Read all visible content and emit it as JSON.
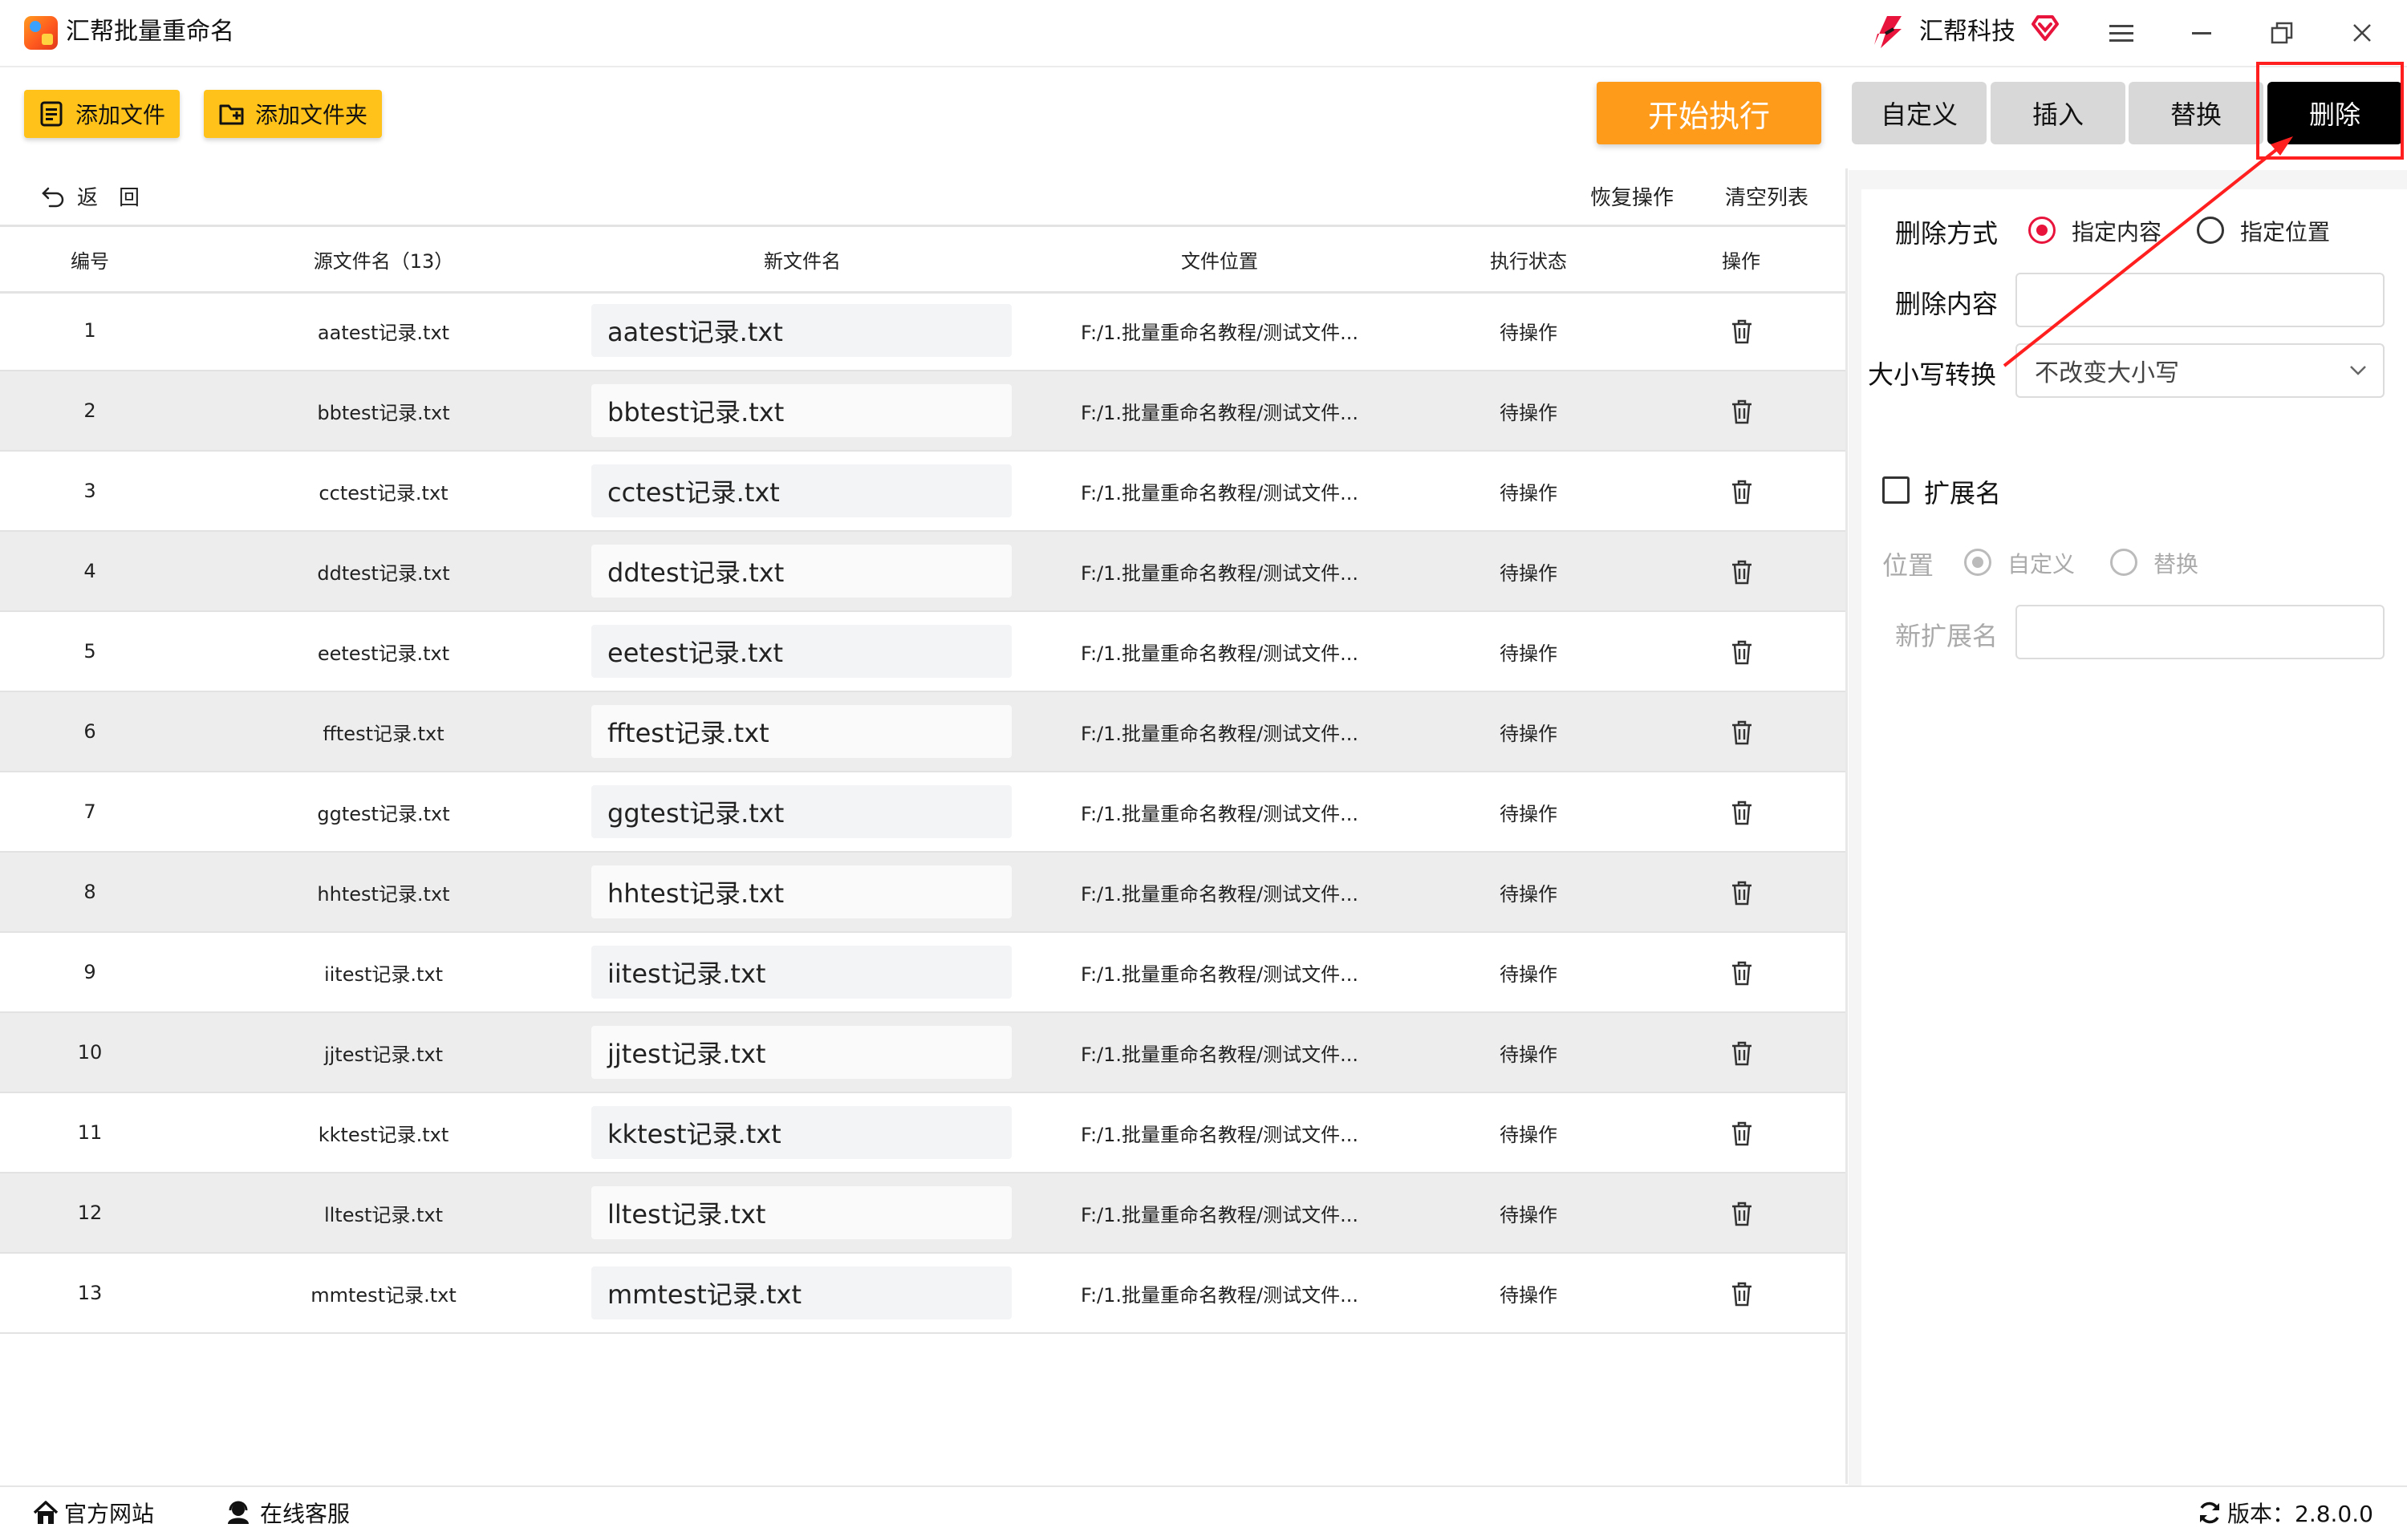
{
  "app": {
    "title": "汇帮批量重命名",
    "brand": "汇帮科技"
  },
  "toolbar": {
    "add_file": "添加文件",
    "add_folder": "添加文件夹",
    "start": "开始执行",
    "tabs": [
      "自定义",
      "插入",
      "替换",
      "删除"
    ],
    "active_tab": "删除"
  },
  "list_toolbar": {
    "back": "返　回",
    "restore": "恢复操作",
    "clear": "清空列表"
  },
  "table": {
    "headers": [
      "编号",
      "源文件名（13）",
      "新文件名",
      "文件位置",
      "执行状态",
      "操作"
    ],
    "rows": [
      {
        "no": "1",
        "src": "aatest记录.txt",
        "new": "aatest记录.txt",
        "path": "F:/1.批量重命名教程/测试文件...",
        "status": "待操作"
      },
      {
        "no": "2",
        "src": "bbtest记录.txt",
        "new": "bbtest记录.txt",
        "path": "F:/1.批量重命名教程/测试文件...",
        "status": "待操作"
      },
      {
        "no": "3",
        "src": "cctest记录.txt",
        "new": "cctest记录.txt",
        "path": "F:/1.批量重命名教程/测试文件...",
        "status": "待操作"
      },
      {
        "no": "4",
        "src": "ddtest记录.txt",
        "new": "ddtest记录.txt",
        "path": "F:/1.批量重命名教程/测试文件...",
        "status": "待操作"
      },
      {
        "no": "5",
        "src": "eetest记录.txt",
        "new": "eetest记录.txt",
        "path": "F:/1.批量重命名教程/测试文件...",
        "status": "待操作"
      },
      {
        "no": "6",
        "src": "fftest记录.txt",
        "new": "fftest记录.txt",
        "path": "F:/1.批量重命名教程/测试文件...",
        "status": "待操作"
      },
      {
        "no": "7",
        "src": "ggtest记录.txt",
        "new": "ggtest记录.txt",
        "path": "F:/1.批量重命名教程/测试文件...",
        "status": "待操作"
      },
      {
        "no": "8",
        "src": "hhtest记录.txt",
        "new": "hhtest记录.txt",
        "path": "F:/1.批量重命名教程/测试文件...",
        "status": "待操作"
      },
      {
        "no": "9",
        "src": "iitest记录.txt",
        "new": "iitest记录.txt",
        "path": "F:/1.批量重命名教程/测试文件...",
        "status": "待操作"
      },
      {
        "no": "10",
        "src": "jjtest记录.txt",
        "new": "jjtest记录.txt",
        "path": "F:/1.批量重命名教程/测试文件...",
        "status": "待操作"
      },
      {
        "no": "11",
        "src": "kktest记录.txt",
        "new": "kktest记录.txt",
        "path": "F:/1.批量重命名教程/测试文件...",
        "status": "待操作"
      },
      {
        "no": "12",
        "src": "lltest记录.txt",
        "new": "lltest记录.txt",
        "path": "F:/1.批量重命名教程/测试文件...",
        "status": "待操作"
      },
      {
        "no": "13",
        "src": "mmtest记录.txt",
        "new": "mmtest记录.txt",
        "path": "F:/1.批量重命名教程/测试文件...",
        "status": "待操作"
      }
    ]
  },
  "panel": {
    "delete_mode_label": "删除方式",
    "mode_options": [
      "指定内容",
      "指定位置"
    ],
    "mode_selected": "指定内容",
    "delete_content_label": "删除内容",
    "delete_content_value": "",
    "case_label": "大小写转换",
    "case_value": "不改变大小写",
    "ext_label": "扩展名",
    "ext_checked": false,
    "position_label": "位置",
    "position_options": [
      "自定义",
      "替换"
    ],
    "position_selected": "自定义",
    "new_ext_label": "新扩展名",
    "new_ext_value": ""
  },
  "statusbar": {
    "website": "官方网站",
    "support": "在线客服",
    "version": "版本：2.8.0.0"
  },
  "colors": {
    "accent_yellow": "#ffc21a",
    "start_orange": "#ff9b1b",
    "active_tab": "#000000",
    "annotation_red": "#ff1f1f",
    "radio_red": "#e8143c"
  }
}
